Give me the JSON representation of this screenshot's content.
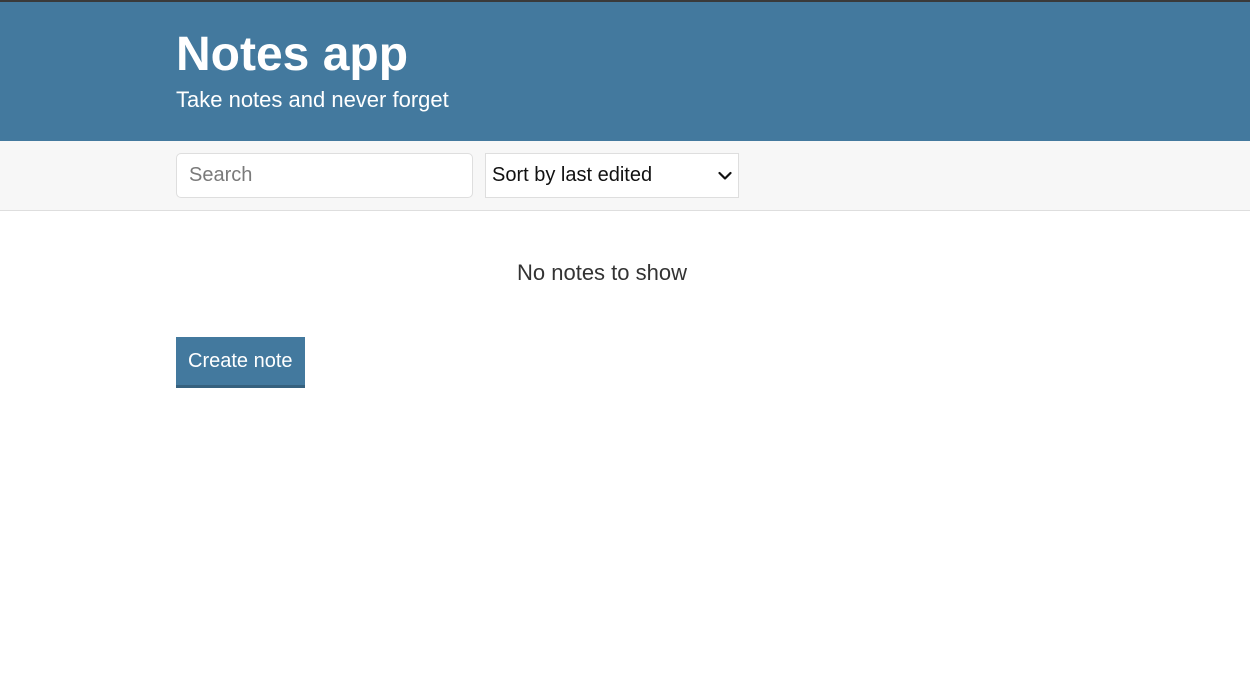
{
  "header": {
    "title": "Notes app",
    "subtitle": "Take notes and never forget"
  },
  "actions": {
    "search_placeholder": "Search",
    "search_value": "",
    "sort_selected": "Sort by last edited"
  },
  "main": {
    "empty_message": "No notes to show",
    "create_label": "Create note"
  },
  "colors": {
    "brand": "#43799e",
    "brand_dark": "#36617e",
    "bar_bg": "#f7f7f7"
  },
  "icons": {
    "sort_dropdown": "chevron-down-icon"
  }
}
